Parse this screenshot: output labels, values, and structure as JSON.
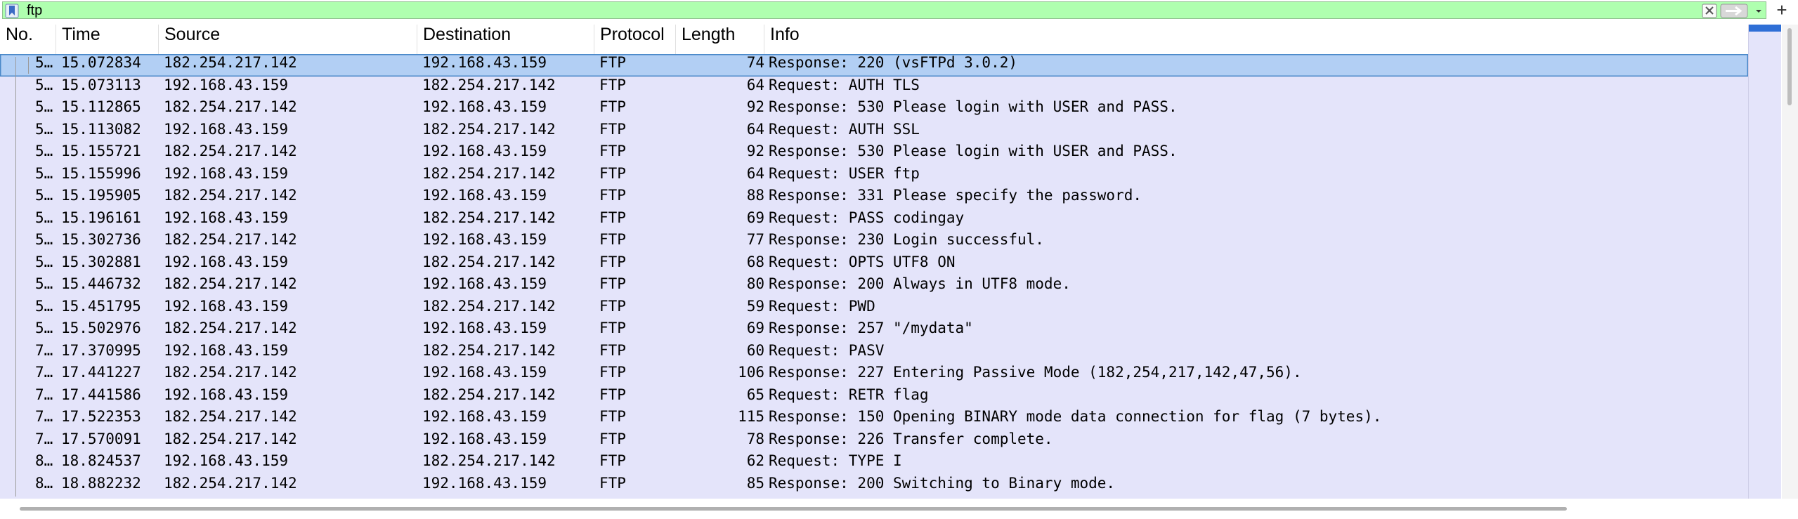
{
  "filter": {
    "value": "ftp",
    "icons": {
      "bookmark": "bookmark-icon",
      "clear": "clear-icon",
      "apply": "apply-arrow-icon",
      "dropdown": "chevron-down-icon",
      "add": "plus-icon"
    },
    "add_label": "+",
    "background_color": "#afffaf"
  },
  "table": {
    "columns": [
      "No.",
      "Time",
      "Source",
      "Destination",
      "Protocol",
      "Length",
      "Info"
    ],
    "row_background": "#e4e4fa",
    "selected_background": "#b2cff4",
    "rows": [
      {
        "no": "5…",
        "time": "15.072834",
        "source": "182.254.217.142",
        "destination": "192.168.43.159",
        "protocol": "FTP",
        "length": "74",
        "info": "Response: 220 (vsFTPd 3.0.2)",
        "selected": true
      },
      {
        "no": "5…",
        "time": "15.073113",
        "source": "192.168.43.159",
        "destination": "182.254.217.142",
        "protocol": "FTP",
        "length": "64",
        "info": "Request: AUTH TLS"
      },
      {
        "no": "5…",
        "time": "15.112865",
        "source": "182.254.217.142",
        "destination": "192.168.43.159",
        "protocol": "FTP",
        "length": "92",
        "info": "Response: 530 Please login with USER and PASS."
      },
      {
        "no": "5…",
        "time": "15.113082",
        "source": "192.168.43.159",
        "destination": "182.254.217.142",
        "protocol": "FTP",
        "length": "64",
        "info": "Request: AUTH SSL"
      },
      {
        "no": "5…",
        "time": "15.155721",
        "source": "182.254.217.142",
        "destination": "192.168.43.159",
        "protocol": "FTP",
        "length": "92",
        "info": "Response: 530 Please login with USER and PASS."
      },
      {
        "no": "5…",
        "time": "15.155996",
        "source": "192.168.43.159",
        "destination": "182.254.217.142",
        "protocol": "FTP",
        "length": "64",
        "info": "Request: USER ftp"
      },
      {
        "no": "5…",
        "time": "15.195905",
        "source": "182.254.217.142",
        "destination": "192.168.43.159",
        "protocol": "FTP",
        "length": "88",
        "info": "Response: 331 Please specify the password."
      },
      {
        "no": "5…",
        "time": "15.196161",
        "source": "192.168.43.159",
        "destination": "182.254.217.142",
        "protocol": "FTP",
        "length": "69",
        "info": "Request: PASS codingay"
      },
      {
        "no": "5…",
        "time": "15.302736",
        "source": "182.254.217.142",
        "destination": "192.168.43.159",
        "protocol": "FTP",
        "length": "77",
        "info": "Response: 230 Login successful."
      },
      {
        "no": "5…",
        "time": "15.302881",
        "source": "192.168.43.159",
        "destination": "182.254.217.142",
        "protocol": "FTP",
        "length": "68",
        "info": "Request: OPTS UTF8 ON"
      },
      {
        "no": "5…",
        "time": "15.446732",
        "source": "182.254.217.142",
        "destination": "192.168.43.159",
        "protocol": "FTP",
        "length": "80",
        "info": "Response: 200 Always in UTF8 mode."
      },
      {
        "no": "5…",
        "time": "15.451795",
        "source": "192.168.43.159",
        "destination": "182.254.217.142",
        "protocol": "FTP",
        "length": "59",
        "info": "Request: PWD"
      },
      {
        "no": "5…",
        "time": "15.502976",
        "source": "182.254.217.142",
        "destination": "192.168.43.159",
        "protocol": "FTP",
        "length": "69",
        "info": "Response: 257 \"/mydata\""
      },
      {
        "no": "7…",
        "time": "17.370995",
        "source": "192.168.43.159",
        "destination": "182.254.217.142",
        "protocol": "FTP",
        "length": "60",
        "info": "Request: PASV"
      },
      {
        "no": "7…",
        "time": "17.441227",
        "source": "182.254.217.142",
        "destination": "192.168.43.159",
        "protocol": "FTP",
        "length": "106",
        "info": "Response: 227 Entering Passive Mode (182,254,217,142,47,56)."
      },
      {
        "no": "7…",
        "time": "17.441586",
        "source": "192.168.43.159",
        "destination": "182.254.217.142",
        "protocol": "FTP",
        "length": "65",
        "info": "Request: RETR flag"
      },
      {
        "no": "7…",
        "time": "17.522353",
        "source": "182.254.217.142",
        "destination": "192.168.43.159",
        "protocol": "FTP",
        "length": "115",
        "info": "Response: 150 Opening BINARY mode data connection for flag (7 bytes)."
      },
      {
        "no": "7…",
        "time": "17.570091",
        "source": "182.254.217.142",
        "destination": "192.168.43.159",
        "protocol": "FTP",
        "length": "78",
        "info": "Response: 226 Transfer complete."
      },
      {
        "no": "8…",
        "time": "18.824537",
        "source": "192.168.43.159",
        "destination": "182.254.217.142",
        "protocol": "FTP",
        "length": "62",
        "info": "Request: TYPE I"
      },
      {
        "no": "8…",
        "time": "18.882232",
        "source": "182.254.217.142",
        "destination": "192.168.43.159",
        "protocol": "FTP",
        "length": "85",
        "info": "Response: 200 Switching to Binary mode."
      }
    ]
  }
}
